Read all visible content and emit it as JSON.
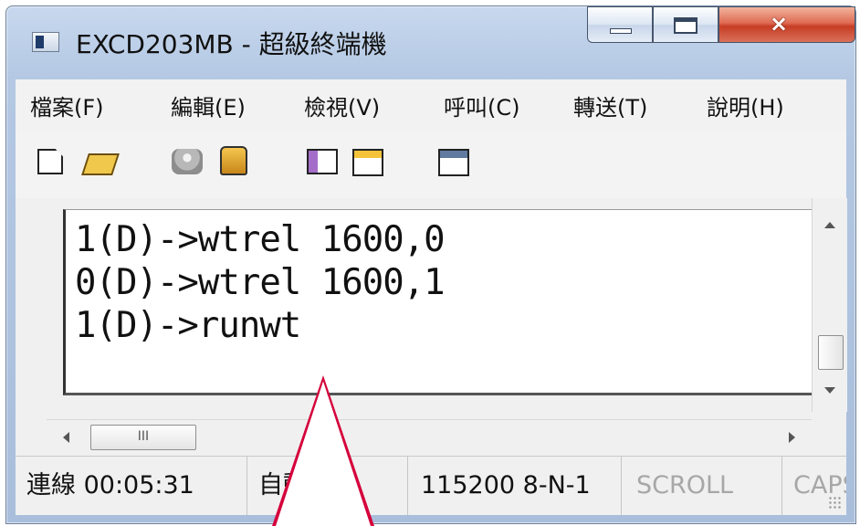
{
  "window": {
    "title": "EXCD203MB - 超級終端機"
  },
  "menu": {
    "items": [
      "檔案(F)",
      "編輯(E)",
      "檢視(V)",
      "呼叫(C)",
      "轉送(T)",
      "說明(H)"
    ]
  },
  "toolbar": {
    "icons": [
      "new-document-icon",
      "open-folder-icon",
      "disconnect-phone-icon",
      "connect-phone-icon",
      "send-file-icon",
      "receive-file-icon",
      "properties-icon"
    ]
  },
  "terminal": {
    "lines": [
      "1(D)->wtrel 1600,0",
      "0(D)->wtrel 1600,1",
      "1(D)->runwt"
    ]
  },
  "scrollbar": {
    "thumb_label": "III"
  },
  "status": {
    "connection": "連線 00:05:31",
    "detect": "自動偵測",
    "serial": "115200 8-N-1",
    "scroll": "SCROLL",
    "caps": "CAPS"
  },
  "colors": {
    "annotation": "#d5003b"
  }
}
